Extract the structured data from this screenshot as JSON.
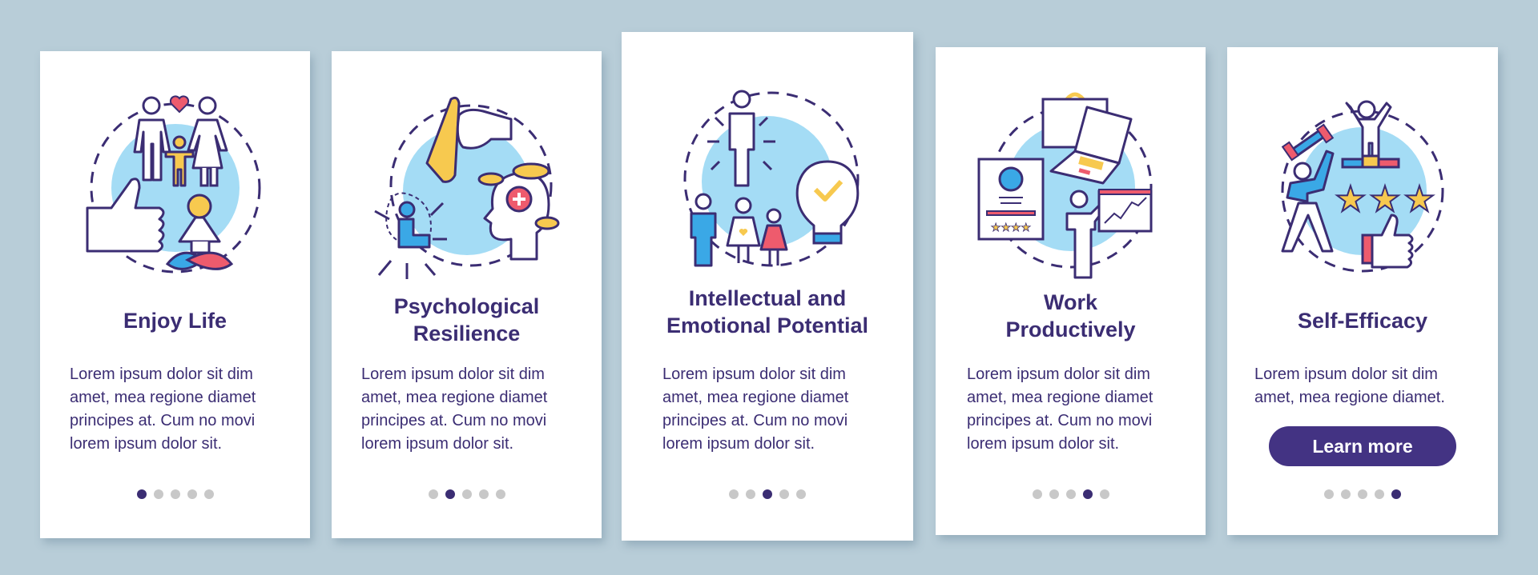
{
  "colors": {
    "background": "#b8cdd8",
    "card": "#ffffff",
    "text": "#3b2d73",
    "button": "#433383",
    "dot_inactive": "#c8c8c8",
    "dot_active": "#3b2d73",
    "accent_blue": "#a4dcf5",
    "accent_yellow": "#f7c94f",
    "accent_red": "#ee5b6d",
    "accent_blue_dark": "#3aa8e6"
  },
  "cards": [
    {
      "title": "Enjoy Life",
      "illustration": "family-meditation-thumbs-up-icon",
      "body": [
        "Lorem ipsum dolor sit dim",
        "amet, mea regione diamet",
        "principes at. Cum no movi",
        "lorem ipsum dolor sit."
      ],
      "active_page": 1
    },
    {
      "title": "Psychological Resilience",
      "title_lines": [
        "Psychological",
        "Resilience"
      ],
      "illustration": "hand-fist-head-resilience-icon",
      "body": [
        "Lorem ipsum dolor sit dim",
        "amet, mea regione diamet",
        "principes at. Cum no movi",
        "lorem ipsum dolor sit."
      ],
      "active_page": 2
    },
    {
      "title": "Intellectual and Emotional Potential",
      "title_lines": [
        "Intellectual and",
        "Emotional Potential"
      ],
      "illustration": "person-family-lightbulb-icon",
      "body": [
        "Lorem ipsum dolor sit dim",
        "amet, mea regione diamet",
        "principes at. Cum no movi",
        "lorem ipsum dolor sit."
      ],
      "active_page": 3
    },
    {
      "title": "Work Productively",
      "title_lines": [
        "Work",
        "Productively"
      ],
      "illustration": "briefcase-laptop-resume-presentation-icon",
      "body": [
        "Lorem ipsum dolor sit dim",
        "amet, mea regione diamet",
        "principes at. Cum no movi",
        "lorem ipsum dolor sit."
      ],
      "active_page": 4
    },
    {
      "title": "Self-Efficacy",
      "illustration": "athlete-podium-stars-thumbs-up-icon",
      "body": [
        "Lorem ipsum dolor sit dim",
        "amet, mea regione diamet."
      ],
      "button_label": "Learn more",
      "active_page": 5
    }
  ],
  "pagination": {
    "total_pages": 5
  }
}
